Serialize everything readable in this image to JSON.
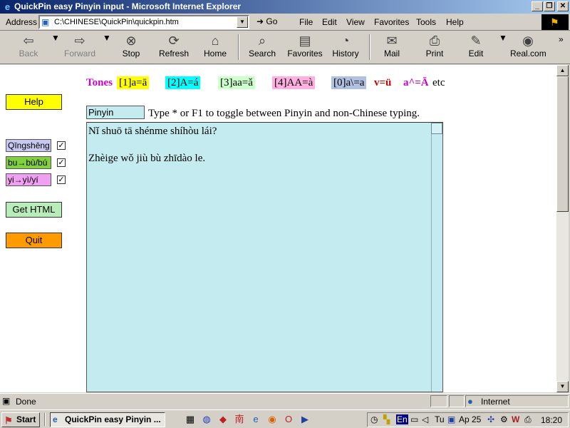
{
  "window": {
    "title": "QuickPin easy Pinyin input - Microsoft Internet Explorer"
  },
  "address": {
    "label": "Address",
    "url": "C:\\CHINESE\\QuickPin\\quickpin.htm",
    "go_label": "Go"
  },
  "menu": [
    "File",
    "Edit",
    "View",
    "Favorites",
    "Tools",
    "Help"
  ],
  "toolbar": {
    "back": "Back",
    "forward": "Forward",
    "stop": "Stop",
    "refresh": "Refresh",
    "home": "Home",
    "search": "Search",
    "favorites": "Favorites",
    "history": "History",
    "mail": "Mail",
    "print": "Print",
    "edit": "Edit",
    "real": "Real.com"
  },
  "side": {
    "help": "Help",
    "options": [
      "Qīngshēng",
      "bu→bù/bú",
      "yi→yì/yí"
    ],
    "get_html": "Get HTML",
    "quit": "Quit"
  },
  "tones": {
    "label": "Tones",
    "t1": "[1]a=ā",
    "t2": "[2]A=á",
    "t3": "[3]aa=ǎ",
    "t4": "[4]AA=à",
    "t0": "[0]a\\=a",
    "v": "v=ü",
    "cap": "a^=Ā",
    "etc": "etc"
  },
  "mode": {
    "value": "Pinyin",
    "hint": "Type * or F1 to toggle between Pinyin and non-Chinese typing."
  },
  "editor": {
    "lines": [
      "Nǐ shuō tā shénme shíhòu lái?",
      "",
      "Zhèige wǒ jiù bù zhīdào le."
    ]
  },
  "status": {
    "text": "Done",
    "zone": "Internet"
  },
  "taskbar": {
    "start": "Start",
    "task": "QuickPin easy Pinyin ...",
    "clock": "18:20",
    "lang": "En",
    "tu": "Tu",
    "ap": "Ap 25"
  },
  "colors": {
    "tone1": "#ffff00",
    "tone2": "#00ffff",
    "tone3": "#ccffcc",
    "tone4": "#ffb0e0",
    "tone0": "#b0c0e0",
    "qingsheng": "#c8c8f0",
    "bu": "#80d040",
    "yi": "#f0a0f0",
    "help_btn": "#ffff00",
    "gethtml_btn": "#b8ecb8",
    "quit_btn": "#ff9a00",
    "editor_bg": "#c4ecf0"
  }
}
